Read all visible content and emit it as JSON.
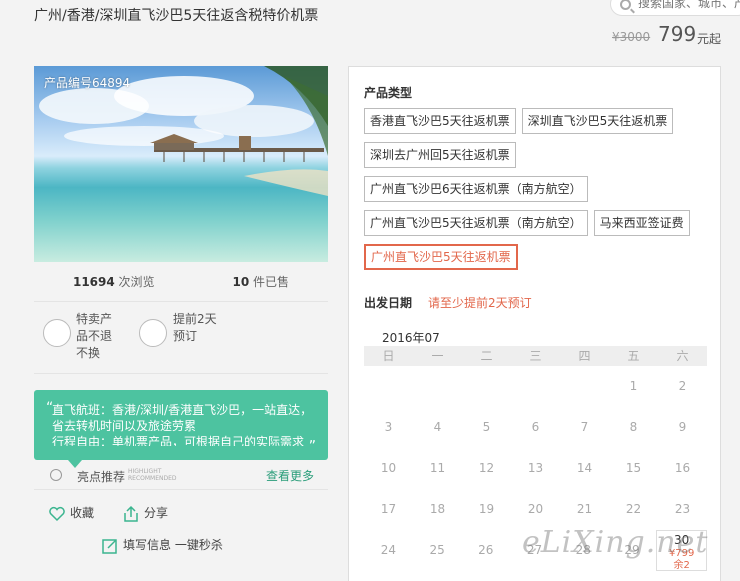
{
  "page": {
    "title": "广州/香港/深圳直飞沙巴5天往返含税特价机票",
    "search_placeholder": "搜索国家、城市、产品",
    "price_old": "¥3000",
    "price_now": "799",
    "price_unit": "元起"
  },
  "product": {
    "code": "产品编号64894",
    "views_count": "11694",
    "views_label": " 次浏览",
    "sold_count": "10",
    "sold_label": " 件已售",
    "feature1": "特卖产\n品不退\n不换",
    "feature2": "提前2天\n预订",
    "promo_text": "直飞航班：香港/深圳/香港直飞沙巴，一站直达，省去转机时间以及旅途劳累\n行程自由：单机票产品，可根据自己的实际需求安排行程",
    "recommend_label": "亮点推荐",
    "recommend_sub": "HIGHLIGHT\nRECOMMENDED",
    "recommend_more": "查看更多",
    "fav_label": "收藏",
    "share_label": "分享",
    "fill_label": "填写信息 一键秒杀"
  },
  "booking": {
    "type_title": "产品类型",
    "types": [
      "香港直飞沙巴5天往返机票",
      "深圳直飞沙巴5天往返机票",
      "深圳去广州回5天往返机票",
      "广州直飞沙巴6天往返机票（南方航空）",
      "广州直飞沙巴5天往返机票（南方航空）",
      "马来西亚签证费",
      "广州直飞沙巴5天往返机票"
    ],
    "selected_type_index": 6,
    "date_title": "出发日期",
    "date_tip": "请至少提前2天预订",
    "month": "2016年07",
    "weekdays": [
      "日",
      "一",
      "二",
      "三",
      "四",
      "五",
      "六"
    ],
    "weeks": [
      [
        "",
        "",
        "",
        "",
        "",
        "1",
        "2"
      ],
      [
        "3",
        "4",
        "5",
        "6",
        "7",
        "8",
        "9"
      ],
      [
        "10",
        "11",
        "12",
        "13",
        "14",
        "15",
        "16"
      ],
      [
        "17",
        "18",
        "19",
        "20",
        "21",
        "22",
        "23"
      ],
      [
        "24",
        "25",
        "26",
        "27",
        "28",
        "29",
        "30"
      ]
    ],
    "available_day": "30",
    "available_price": "¥799",
    "available_stock": "余2"
  },
  "watermark": "eLiXing.net",
  "colors": {
    "accent": "#e2674b",
    "promo": "#4dc3a0",
    "link": "#2a9d7a"
  }
}
